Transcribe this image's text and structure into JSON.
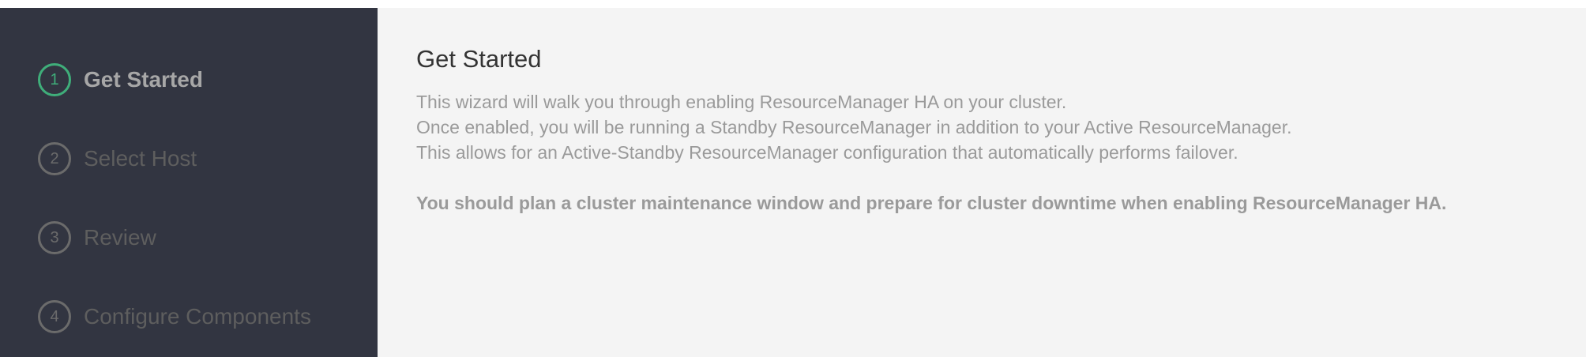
{
  "sidebar": {
    "steps": [
      {
        "number": "1",
        "label": "Get Started",
        "active": true
      },
      {
        "number": "2",
        "label": "Select Host",
        "active": false
      },
      {
        "number": "3",
        "label": "Review",
        "active": false
      },
      {
        "number": "4",
        "label": "Configure Components",
        "active": false
      }
    ]
  },
  "main": {
    "title": "Get Started",
    "lines": [
      "This wizard will walk you through enabling ResourceManager HA on your cluster.",
      "Once enabled, you will be running a Standby ResourceManager in addition to your Active ResourceManager.",
      "This allows for an Active-Standby ResourceManager configuration that automatically performs failover."
    ],
    "warning": "You should plan a cluster maintenance window and prepare for cluster downtime when enabling ResourceManager HA."
  },
  "colors": {
    "sidebar_bg": "#323541",
    "content_bg": "#f4f4f4",
    "active_step": "#3fae7a",
    "inactive_step": "#6b6b6b"
  }
}
